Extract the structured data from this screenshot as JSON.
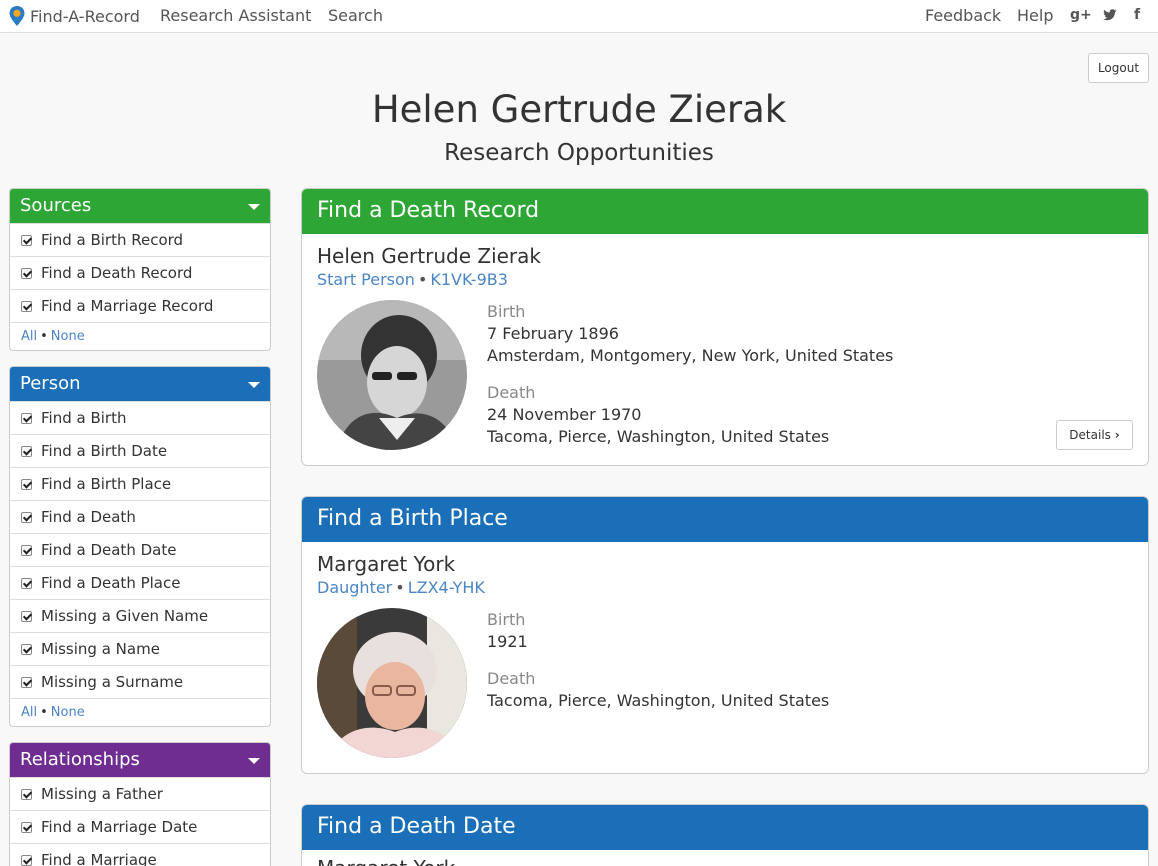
{
  "nav": {
    "brand": "Find-A-Record",
    "links": [
      "Research Assistant",
      "Search"
    ],
    "right_links": [
      "Feedback",
      "Help"
    ],
    "social": [
      "g+",
      "twitter-icon",
      "f"
    ]
  },
  "logout_label": "Logout",
  "title": "Helen Gertrude Zierak",
  "subtitle": "Research Opportunities",
  "sidebar": {
    "sources": {
      "title": "Sources",
      "color": "#2ea636",
      "items": [
        "Find a Birth Record",
        "Find a Death Record",
        "Find a Marriage Record"
      ],
      "all": "All",
      "none": "None"
    },
    "person": {
      "title": "Person",
      "color": "#1a6fb8",
      "items": [
        "Find a Birth",
        "Find a Birth Date",
        "Find a Birth Place",
        "Find a Death",
        "Find a Death Date",
        "Find a Death Place",
        "Missing a Given Name",
        "Missing a Name",
        "Missing a Surname"
      ],
      "all": "All",
      "none": "None"
    },
    "relationships": {
      "title": "Relationships",
      "color": "#6f2c91",
      "items": [
        "Missing a Father",
        "Find a Marriage Date",
        "Find a Marriage"
      ]
    }
  },
  "cards": [
    {
      "title": "Find a Death Record",
      "color": "#2ea636",
      "name": "Helen Gertrude Zierak",
      "relation": "Start Person",
      "pid": "K1VK-9B3",
      "birth_label": "Birth",
      "birth_date": "7 February 1896",
      "birth_place": "Amsterdam, Montgomery, New York, United States",
      "death_label": "Death",
      "death_date": "24 November 1970",
      "death_place": "Tacoma, Pierce, Washington, United States",
      "details_label": "Details"
    },
    {
      "title": "Find a Birth Place",
      "color": "#1a6fb8",
      "name": "Margaret York",
      "relation": "Daughter",
      "pid": "LZX4-YHK",
      "birth_label": "Birth",
      "birth_date": "1921",
      "death_label": "Death",
      "death_place": "Tacoma, Pierce, Washington, United States"
    },
    {
      "title": "Find a Death Date",
      "color": "#1a6fb8",
      "name": "Margaret York"
    }
  ]
}
